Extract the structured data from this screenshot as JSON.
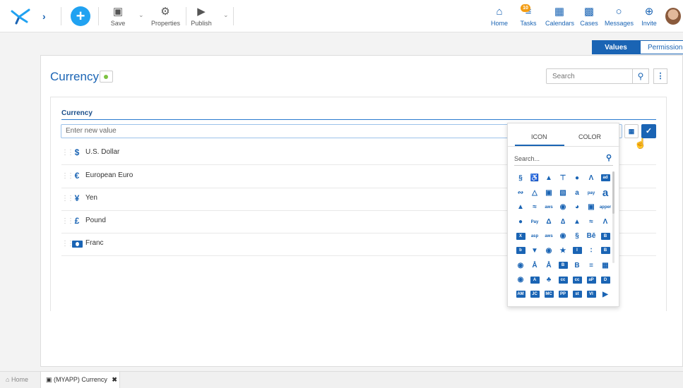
{
  "toolbar": {
    "save_label": "Save",
    "properties_label": "Properties",
    "publish_label": "Publish"
  },
  "nav": {
    "home": "Home",
    "tasks": "Tasks",
    "tasks_badge": "10",
    "calendars": "Calendars",
    "cases": "Cases",
    "messages": "Messages",
    "invite": "Invite"
  },
  "view_tabs": {
    "values": "Values",
    "permissions": "Permissions"
  },
  "page": {
    "title": "Currency",
    "search_placeholder": "Search",
    "status_color": "#7dc242"
  },
  "field": {
    "label": "Currency",
    "new_value_placeholder": "Enter new value"
  },
  "items": [
    {
      "label": "U.S. Dollar",
      "icon": "hand-dollar-icon",
      "glyph": "$"
    },
    {
      "label": "European Euro",
      "icon": "euro-icon",
      "glyph": "€"
    },
    {
      "label": "Yen",
      "icon": "yen-icon",
      "glyph": "¥"
    },
    {
      "label": "Pound",
      "icon": "pound-icon",
      "glyph": "£"
    },
    {
      "label": "Franc",
      "icon": "money-bill-icon",
      "glyph": ""
    }
  ],
  "icon_picker": {
    "tab_icon": "ICON",
    "tab_color": "COLOR",
    "search_placeholder": "Search..."
  },
  "bottom_tabs": {
    "home": "Home",
    "active": "(MYAPP) Currency"
  },
  "colors": {
    "accent": "#1a64b4",
    "brand_blue": "#21a2f1",
    "badge": "#f39c12"
  }
}
